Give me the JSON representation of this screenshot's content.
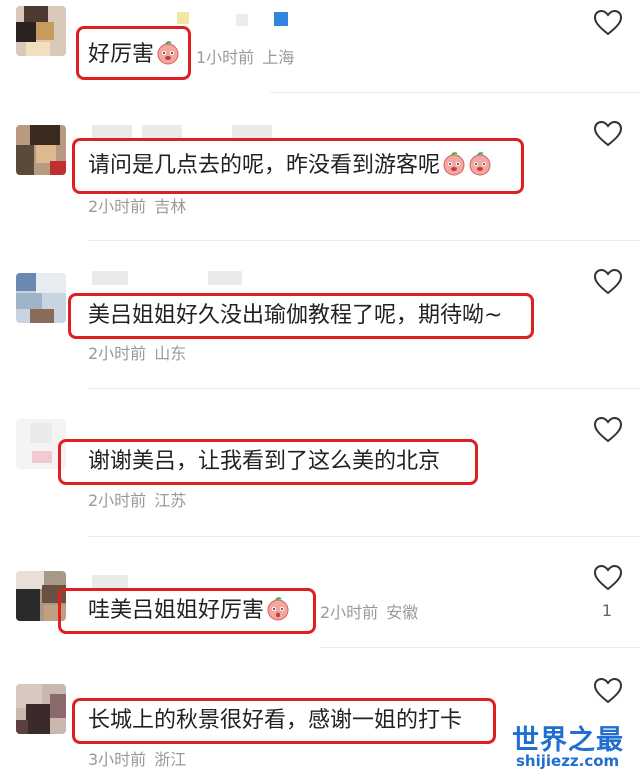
{
  "colors": {
    "highlight_box": "#e02020",
    "meta_text": "#9a9a9a",
    "watermark": "#1f6fd1"
  },
  "icons": {
    "like": "heart-outline-icon",
    "emoji": "peach-face-icon"
  },
  "comments": [
    {
      "text": "好厉害",
      "emoji_count": 1,
      "time": "1小时前",
      "location": "上海",
      "likes": ""
    },
    {
      "text": "请问是几点去的呢，昨没看到游客呢",
      "emoji_count": 2,
      "time": "2小时前",
      "location": "吉林",
      "likes": ""
    },
    {
      "text": "美吕姐姐好久没出瑜伽教程了呢，期待呦~",
      "emoji_count": 0,
      "time": "2小时前",
      "location": "山东",
      "likes": ""
    },
    {
      "text": "谢谢美吕，让我看到了这么美的北京",
      "emoji_count": 0,
      "time": "2小时前",
      "location": "江苏",
      "likes": ""
    },
    {
      "text": "哇美吕姐姐好厉害",
      "emoji_count": 1,
      "time": "2小时前",
      "location": "安徽",
      "likes": "1"
    },
    {
      "text": "长城上的秋景很好看，感谢一姐的打卡",
      "emoji_count": 0,
      "time": "3小时前",
      "location": "浙江",
      "likes": ""
    }
  ],
  "watermark": {
    "title": "世界之最",
    "subtitle": "shijiezz.com"
  }
}
